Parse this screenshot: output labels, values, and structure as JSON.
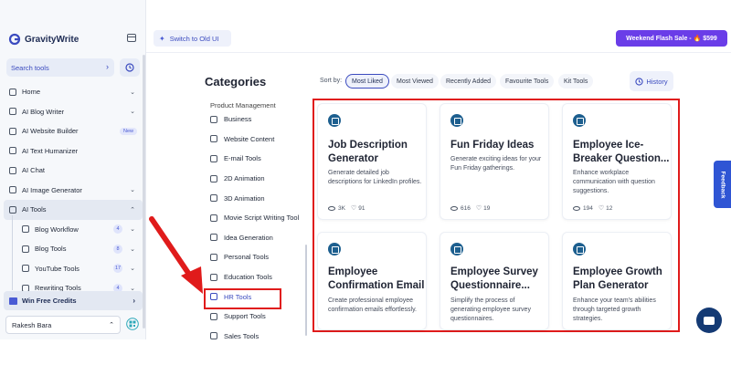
{
  "app": {
    "name": "GravityWrite"
  },
  "sidebar": {
    "search_label": "Search tools",
    "items": [
      {
        "label": "Home",
        "caret": "⌄"
      },
      {
        "label": "AI Blog Writer",
        "caret": "⌄"
      },
      {
        "label": "AI Website Builder",
        "badge": "New"
      },
      {
        "label": "AI Text Humanizer"
      },
      {
        "label": "AI Chat"
      },
      {
        "label": "AI Image Generator",
        "caret": "⌄"
      },
      {
        "label": "AI Tools",
        "caret": "⌃"
      }
    ],
    "sub_items": [
      {
        "label": "Blog Workflow",
        "count": "4"
      },
      {
        "label": "Blog Tools",
        "count": "8"
      },
      {
        "label": "YouTube Tools",
        "count": "17"
      },
      {
        "label": "Rewriting Tools",
        "count": "4"
      }
    ],
    "win_credits": "Win Free Credits",
    "user_name": "Rakesh Bara"
  },
  "topbar": {
    "switch_label": "Switch to Old UI",
    "flash_label": "Weekend Flash Sale - 🔥 $599"
  },
  "categories": {
    "title": "Categories",
    "partial_top": "Product Management",
    "items": [
      "Business",
      "Website Content",
      "E-mail Tools",
      "2D Animation",
      "3D Animation",
      "Movie Script Writing Tool",
      "Idea Generation",
      "Personal Tools",
      "Education Tools",
      "HR Tools",
      "Support Tools"
    ],
    "partial_bottom": "Sales Tools"
  },
  "sort": {
    "label": "Sort by:",
    "options": [
      "Most Liked",
      "Most Viewed",
      "Recently Added",
      "Favourite Tools",
      "Kit Tools"
    ],
    "history": "History"
  },
  "cards": [
    {
      "title": "Job Description Generator",
      "desc": "Generate detailed job descriptions for LinkedIn profiles.",
      "views": "3K",
      "likes": "91"
    },
    {
      "title": "Fun Friday Ideas",
      "desc": "Generate exciting ideas for your Fun Friday gatherings.",
      "views": "616",
      "likes": "19"
    },
    {
      "title": "Employee Ice-Breaker Question...",
      "desc": "Enhance workplace communication with question suggestions.",
      "views": "194",
      "likes": "12"
    },
    {
      "title": "Employee Confirmation Email",
      "desc": "Create professional employee confirmation emails effortlessly.",
      "views": "",
      "likes": ""
    },
    {
      "title": "Employee Survey Questionnaire...",
      "desc": "Simplify the process of generating employee survey questionnaires.",
      "views": "",
      "likes": ""
    },
    {
      "title": "Employee Growth Plan Generator",
      "desc": "Enhance your team's abilities through targeted growth strategies.",
      "views": "",
      "likes": ""
    }
  ],
  "floating": {
    "feedback": "Feedback"
  },
  "colors": {
    "accent": "#3b4bbf",
    "highlight": "#e01b1b",
    "flash": "#6a3de8",
    "tool_icon": "#1d5f8f"
  }
}
